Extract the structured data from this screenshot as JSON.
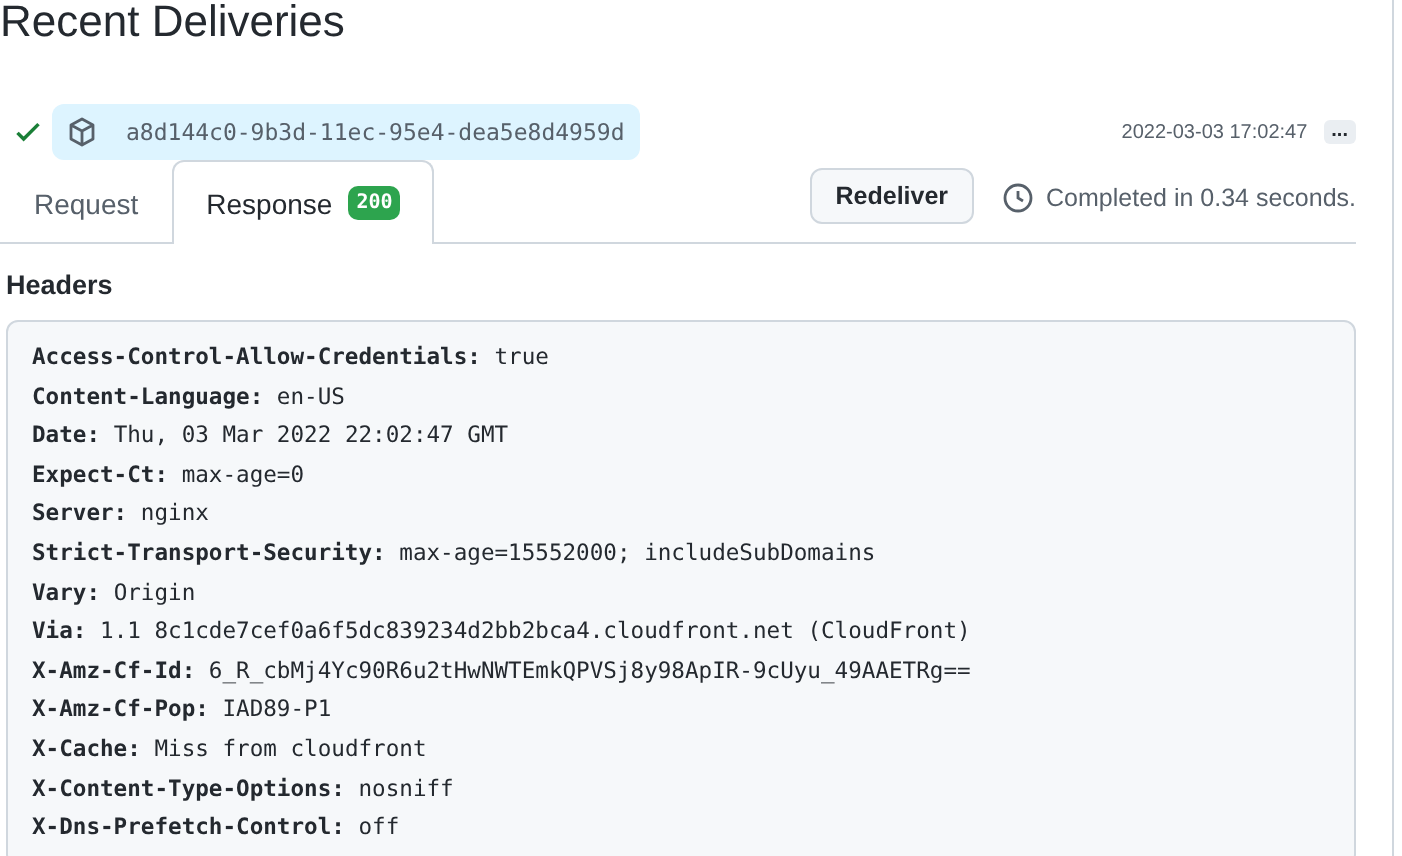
{
  "title": "Recent Deliveries",
  "delivery": {
    "succeeded": true,
    "guid": "a8d144c0-9b3d-11ec-95e4-dea5e8d4959d",
    "time": "2022-03-03 17:02:47",
    "more": "..."
  },
  "tabs": [
    {
      "label": "Request",
      "selected": false
    },
    {
      "label": "Response",
      "selected": true,
      "badge": "200"
    }
  ],
  "redeliver": "Redeliver",
  "duration": "Completed in 0.34 seconds.",
  "section": "Headers",
  "headers": [
    {
      "name": "Access-Control-Allow-Credentials:",
      "value": "true"
    },
    {
      "name": "Content-Language:",
      "value": "en-US"
    },
    {
      "name": "Date:",
      "value": "Thu, 03 Mar 2022 22:02:47 GMT"
    },
    {
      "name": "Expect-Ct:",
      "value": "max-age=0"
    },
    {
      "name": "Server:",
      "value": "nginx"
    },
    {
      "name": "Strict-Transport-Security:",
      "value": "max-age=15552000; includeSubDomains"
    },
    {
      "name": "Vary:",
      "value": "Origin"
    },
    {
      "name": "Via:",
      "value": "1.1 8c1cde7cef0a6f5dc839234d2bb2bca4.cloudfront.net (CloudFront)"
    },
    {
      "name": "X-Amz-Cf-Id:",
      "value": "6_R_cbMj4Yc90R6u2tHwNWTEmkQPVSj8y98ApIR-9cUyu_49AAETRg=="
    },
    {
      "name": "X-Amz-Cf-Pop:",
      "value": "IAD89-P1"
    },
    {
      "name": "X-Cache:",
      "value": "Miss from cloudfront"
    },
    {
      "name": "X-Content-Type-Options:",
      "value": "nosniff"
    },
    {
      "name": "X-Dns-Prefetch-Control:",
      "value": "off"
    }
  ]
}
